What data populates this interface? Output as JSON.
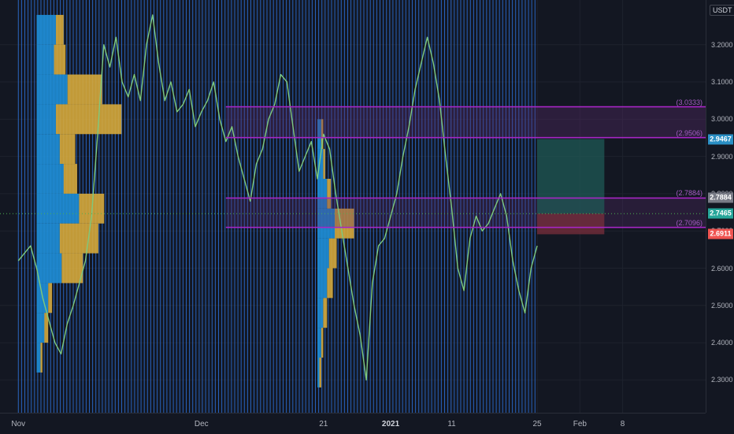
{
  "chart_data": {
    "type": "line",
    "currency": "USDT",
    "y_ticks": [
      "3.2000",
      "3.1000",
      "3.0000",
      "2.9000",
      "2.8000",
      "2.7000",
      "2.6000",
      "2.5000",
      "2.4000",
      "2.3000"
    ],
    "y_tick_values": [
      3.2,
      3.1,
      3.0,
      2.9,
      2.8,
      2.7,
      2.6,
      2.5,
      2.4,
      2.3
    ],
    "ylim": [
      2.212,
      3.32
    ],
    "x_ticks": [
      {
        "label": "Nov",
        "day": 0,
        "bold": false
      },
      {
        "label": "Dec",
        "day": 30,
        "bold": false
      },
      {
        "label": "21",
        "day": 50,
        "bold": false
      },
      {
        "label": "2021",
        "day": 61,
        "bold": true
      },
      {
        "label": "11",
        "day": 71,
        "bold": false
      },
      {
        "label": "25",
        "day": 85,
        "bold": false
      },
      {
        "label": "Feb",
        "day": 92,
        "bold": false
      },
      {
        "label": "8",
        "day": 99,
        "bold": false
      }
    ],
    "xlim": [
      -3,
      112.6
    ],
    "horizontal_levels": [
      {
        "label": "(3.0333)",
        "value": 3.0333
      },
      {
        "label": "(2.9506)",
        "value": 2.9506
      },
      {
        "label": "(2.7884)",
        "value": 2.7884
      },
      {
        "label": "(2.7096)",
        "value": 2.7096
      }
    ],
    "price_tags": [
      {
        "label": "2.9467",
        "value": 2.9467,
        "color": "#2a8fc4"
      },
      {
        "label": "2.7884",
        "value": 2.7884,
        "color": "#787b86"
      },
      {
        "label": "2.7465",
        "value": 2.7465,
        "color": "#26a69a"
      },
      {
        "label": "2.6911",
        "value": 2.6911,
        "color": "#ef5350"
      }
    ],
    "position_box": {
      "entry": 2.7465,
      "target": 2.9467,
      "stop": 2.6911,
      "start_day": 85,
      "end_day": 96
    },
    "price_series": {
      "days": [
        0,
        1,
        2,
        3,
        4,
        5,
        6,
        7,
        8,
        9,
        10,
        11,
        12,
        13,
        14,
        15,
        16,
        17,
        18,
        19,
        20,
        21,
        22,
        23,
        24,
        25,
        26,
        27,
        28,
        29,
        30,
        31,
        32,
        33,
        34,
        35,
        36,
        37,
        38,
        39,
        40,
        41,
        42,
        43,
        44,
        45,
        46,
        47,
        48,
        49,
        50,
        51,
        52,
        53,
        54,
        55,
        56,
        57,
        58,
        59,
        60,
        61,
        62,
        63,
        64,
        65,
        66,
        67,
        68,
        69,
        70,
        71,
        72,
        73,
        74,
        75,
        76,
        77,
        78,
        79,
        80,
        81,
        82,
        83,
        84,
        85
      ],
      "values": [
        2.62,
        2.64,
        2.66,
        2.6,
        2.52,
        2.46,
        2.4,
        2.37,
        2.45,
        2.5,
        2.56,
        2.62,
        2.74,
        2.96,
        3.2,
        3.14,
        3.22,
        3.1,
        3.06,
        3.12,
        3.05,
        3.2,
        3.28,
        3.15,
        3.05,
        3.1,
        3.02,
        3.04,
        3.08,
        2.98,
        3.02,
        3.05,
        3.1,
        3.0,
        2.94,
        2.98,
        2.9,
        2.84,
        2.78,
        2.88,
        2.92,
        3.0,
        3.04,
        3.12,
        3.1,
        2.98,
        2.86,
        2.9,
        2.94,
        2.84,
        2.96,
        2.92,
        2.8,
        2.7,
        2.6,
        2.5,
        2.42,
        2.3,
        2.56,
        2.66,
        2.68,
        2.74,
        2.8,
        2.9,
        2.98,
        3.08,
        3.15,
        3.22,
        3.15,
        3.05,
        2.9,
        2.76,
        2.6,
        2.54,
        2.68,
        2.74,
        2.7,
        2.72,
        2.76,
        2.8,
        2.74,
        2.62,
        2.54,
        2.48,
        2.6,
        2.66
      ]
    },
    "volume_profiles": [
      {
        "start_day": 3,
        "bins": [
          {
            "low": 3.2,
            "high": 3.28,
            "up": 10,
            "down": 4
          },
          {
            "low": 3.12,
            "high": 3.2,
            "up": 9,
            "down": 6
          },
          {
            "low": 3.04,
            "high": 3.12,
            "up": 16,
            "down": 18
          },
          {
            "low": 2.96,
            "high": 3.04,
            "up": 10,
            "down": 34
          },
          {
            "low": 2.88,
            "high": 2.96,
            "up": 12,
            "down": 8
          },
          {
            "low": 2.8,
            "high": 2.88,
            "up": 14,
            "down": 7
          },
          {
            "low": 2.72,
            "high": 2.8,
            "up": 22,
            "down": 13
          },
          {
            "low": 2.64,
            "high": 2.72,
            "up": 12,
            "down": 20
          },
          {
            "low": 2.56,
            "high": 2.64,
            "up": 13,
            "down": 11
          },
          {
            "low": 2.48,
            "high": 2.56,
            "up": 6,
            "down": 2
          },
          {
            "low": 2.4,
            "high": 2.48,
            "up": 4,
            "down": 2
          },
          {
            "low": 2.32,
            "high": 2.4,
            "up": 2,
            "down": 1
          }
        ]
      },
      {
        "start_day": 49,
        "bins": [
          {
            "low": 2.92,
            "high": 3.0,
            "up": 2,
            "down": 1
          },
          {
            "low": 2.84,
            "high": 2.92,
            "up": 3,
            "down": 1
          },
          {
            "low": 2.76,
            "high": 2.84,
            "up": 5,
            "down": 2
          },
          {
            "low": 2.68,
            "high": 2.76,
            "up": 9,
            "down": 10
          },
          {
            "low": 2.6,
            "high": 2.68,
            "up": 6,
            "down": 4
          },
          {
            "low": 2.52,
            "high": 2.6,
            "up": 5,
            "down": 3
          },
          {
            "low": 2.44,
            "high": 2.52,
            "up": 3,
            "down": 2
          },
          {
            "low": 2.36,
            "high": 2.44,
            "up": 2,
            "down": 1
          },
          {
            "low": 2.28,
            "high": 2.36,
            "up": 1,
            "down": 1
          }
        ]
      }
    ],
    "colors": {
      "background": "#131722",
      "grid": "#1e222d",
      "price_line": "#7ec97e",
      "vertical_lines": "#2b6fd6",
      "profile_up": "#1f8ed6",
      "profile_down": "#d6a93b",
      "level_line": "#a626c4",
      "zone_fill": "#5b2a6e",
      "target_fill": "#1f5a56",
      "stop_fill": "#7a2f3c"
    }
  }
}
